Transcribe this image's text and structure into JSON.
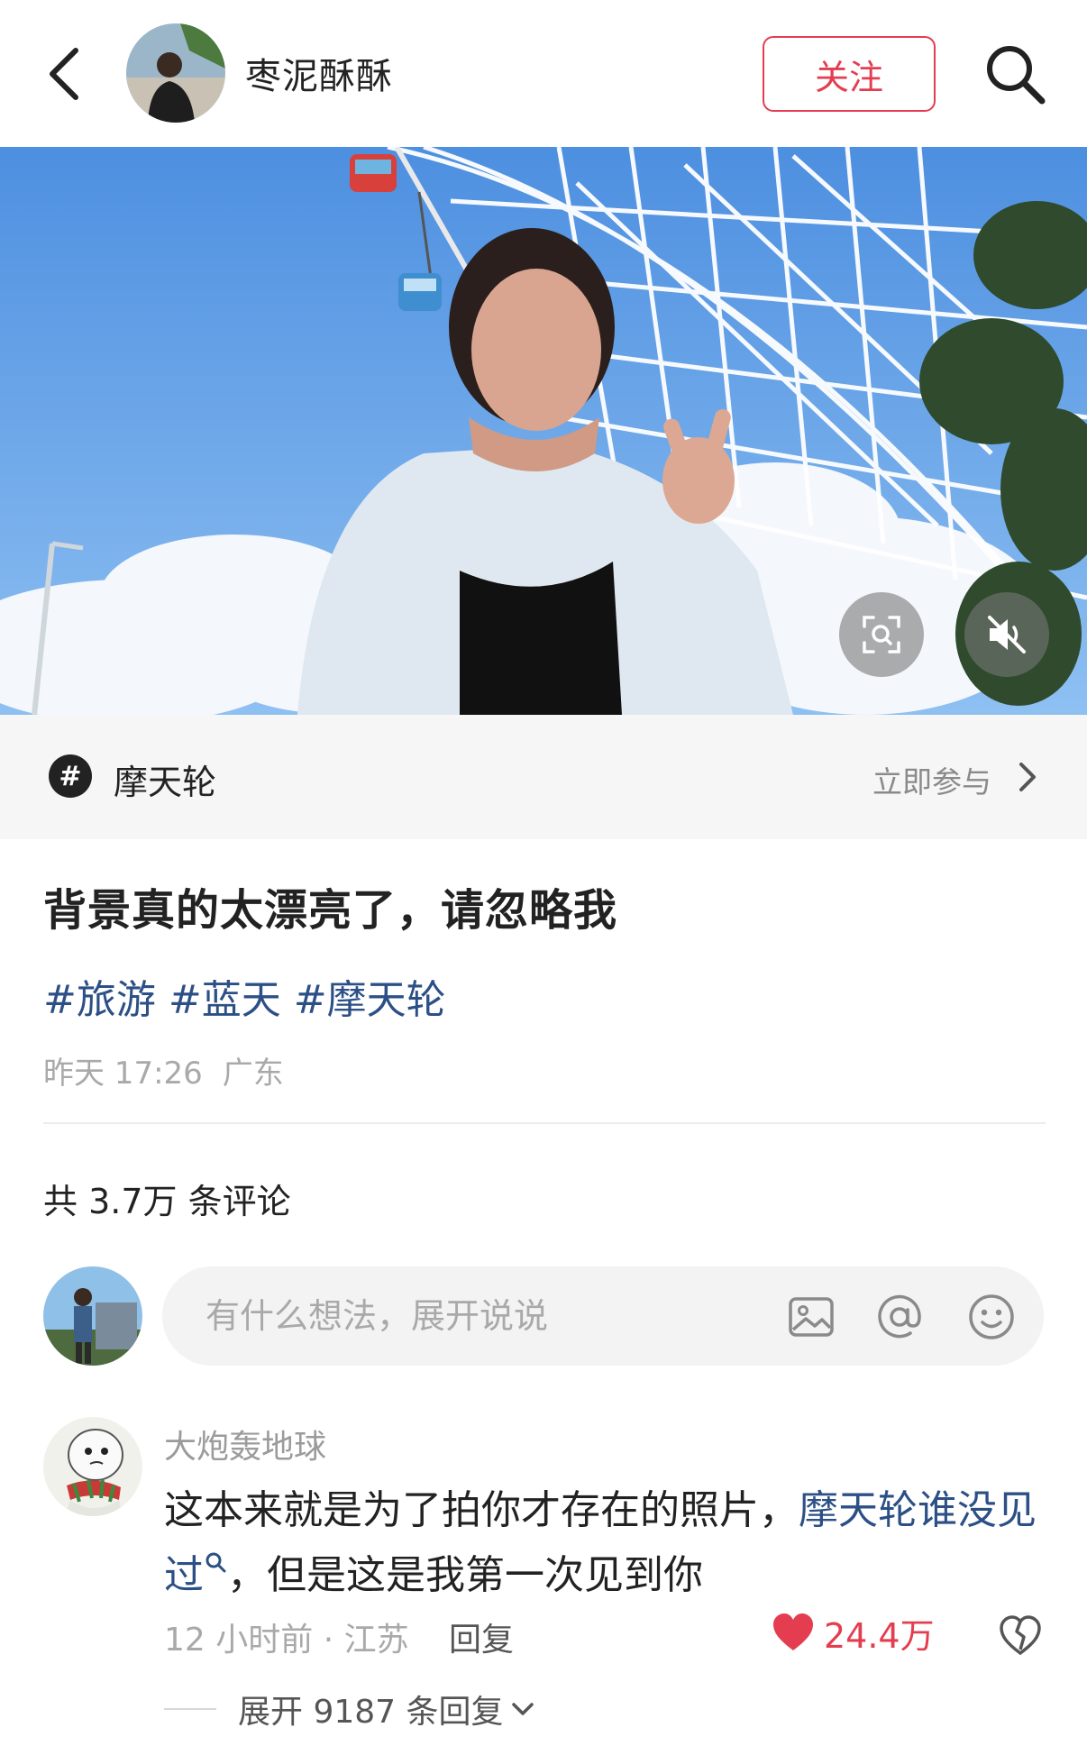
{
  "header": {
    "author_name": "枣泥酥酥",
    "follow_label": "关注"
  },
  "topic": {
    "icon_symbol": "#",
    "name": "摩天轮",
    "join_label": "立即参与"
  },
  "post": {
    "title": "背景真的太漂亮了，请忽略我",
    "tags": [
      "#旅游",
      "#蓝天",
      "#摩天轮"
    ],
    "time": "昨天 17:26",
    "location": "广东"
  },
  "comments": {
    "count_label": "共 3.7万 条评论",
    "input_placeholder": "有什么想法，展开说说",
    "items": [
      {
        "user": "大炮轰地球",
        "text_before": "这本来就是为了拍你才存在的照片，",
        "link_text": "摩天轮谁没见过",
        "text_after": "，但是这是我第一次见到你",
        "meta": "12 小时前 · 江苏",
        "reply_label": "回复",
        "likes": "24.4万",
        "expand_label": "展开 9187 条回复"
      }
    ]
  },
  "colors": {
    "accent_red": "#e43d50",
    "link_blue": "#2c4f86",
    "muted_gray": "#a9a9a9"
  },
  "icons": [
    "back-icon",
    "search-icon",
    "scan-icon",
    "mute-icon",
    "hashtag-icon",
    "chevron-right-icon",
    "image-icon",
    "at-icon",
    "emoji-icon",
    "heart-icon",
    "dislike-icon",
    "chevron-down-icon"
  ]
}
